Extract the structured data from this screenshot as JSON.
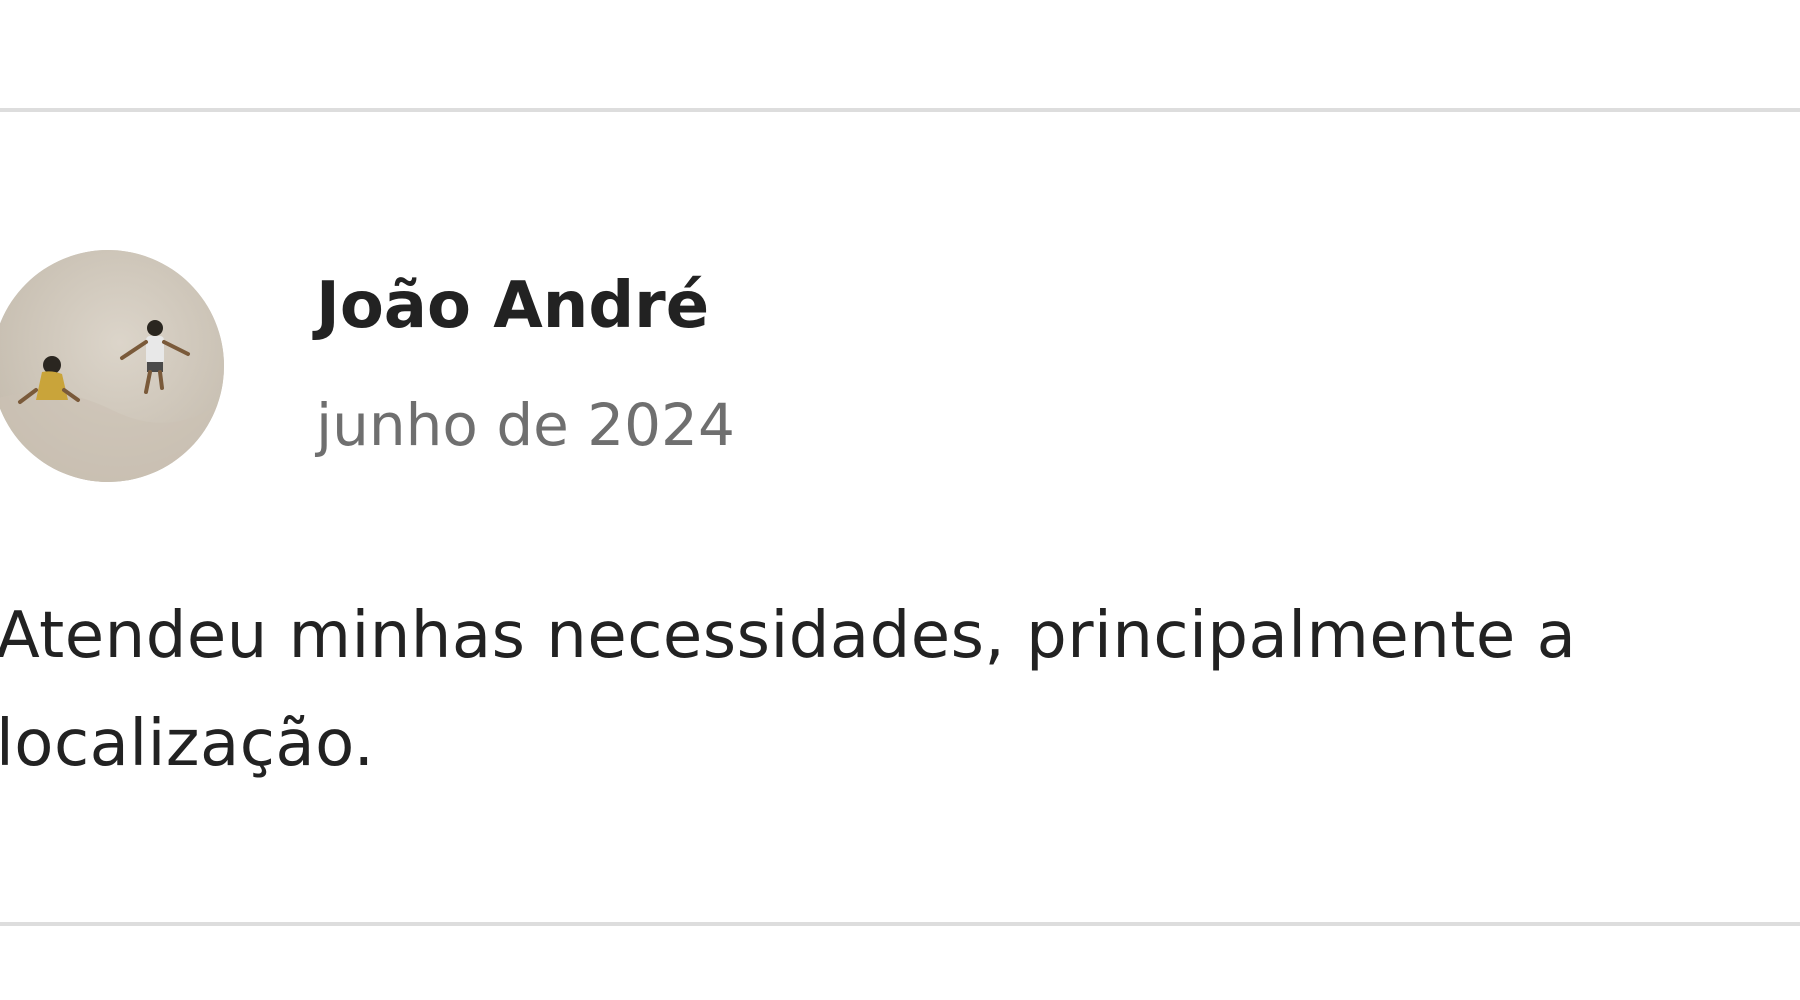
{
  "review": {
    "reviewer_name": "João André",
    "date": "junho de 2024",
    "text": "Atendeu minhas necessidades, principalmente a localização."
  },
  "avatar": {
    "icon": "avatar-photo-children-on-sand-dune"
  },
  "colors": {
    "text_primary": "#222222",
    "text_secondary": "#6f6f6f",
    "divider": "#dddddd",
    "background": "#ffffff"
  }
}
